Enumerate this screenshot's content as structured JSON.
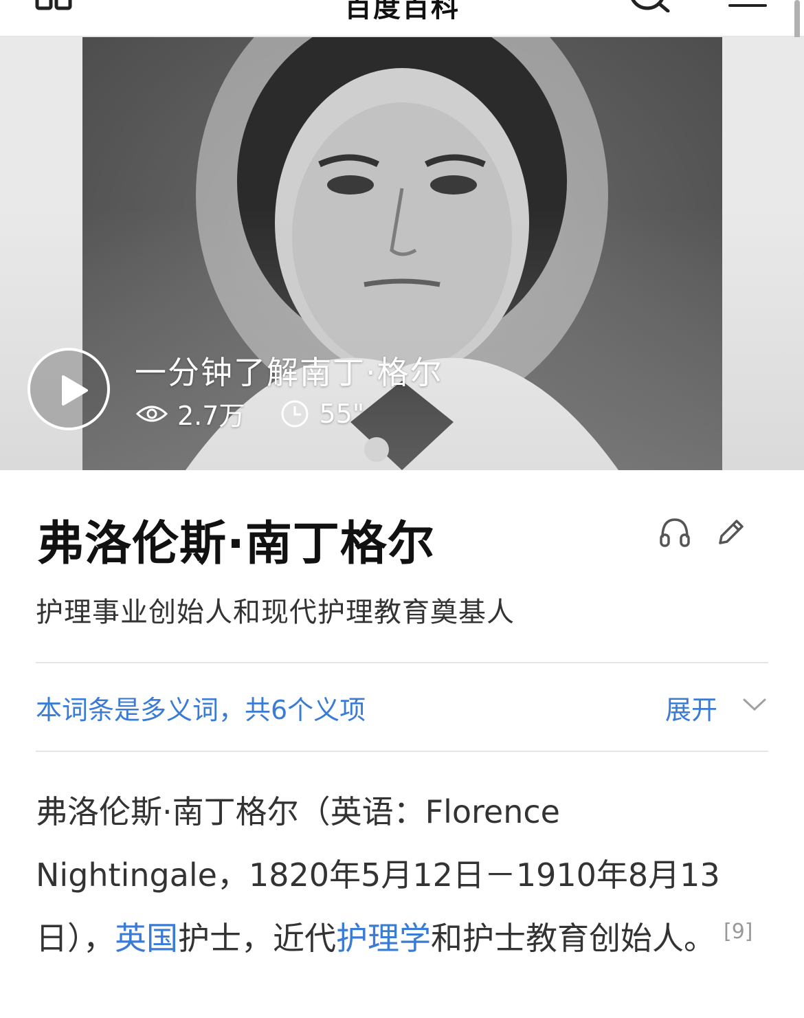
{
  "topbar": {
    "title": "百度百科",
    "icons": [
      "grid-icon",
      "search-icon",
      "menu-icon"
    ]
  },
  "video": {
    "title": "一分钟了解南丁·格尔",
    "views": "2.7万",
    "duration": "55\"",
    "icons": [
      "play-icon",
      "eye-icon",
      "clock-icon"
    ]
  },
  "entry": {
    "title": "弗洛伦斯·南丁格尔",
    "description": "护理事业创始人和现代护理教育奠基人",
    "action_icons": [
      "headphone-icon",
      "pencil-icon"
    ]
  },
  "polysemy": {
    "text": "本词条是多义词，共6个义项",
    "expand_label": "展开"
  },
  "summary": {
    "part1": "弗洛伦斯·南丁格尔（英语：Florence Nightingale，1820年5月12日－1910年8月13日），",
    "link1": "英国",
    "part2": "护士，近代",
    "link2": "护理学",
    "part3": "和护士教育创始人。",
    "ref": "[9]"
  },
  "colors": {
    "link": "#3a7bd5",
    "text": "#333333",
    "title": "#111111"
  }
}
